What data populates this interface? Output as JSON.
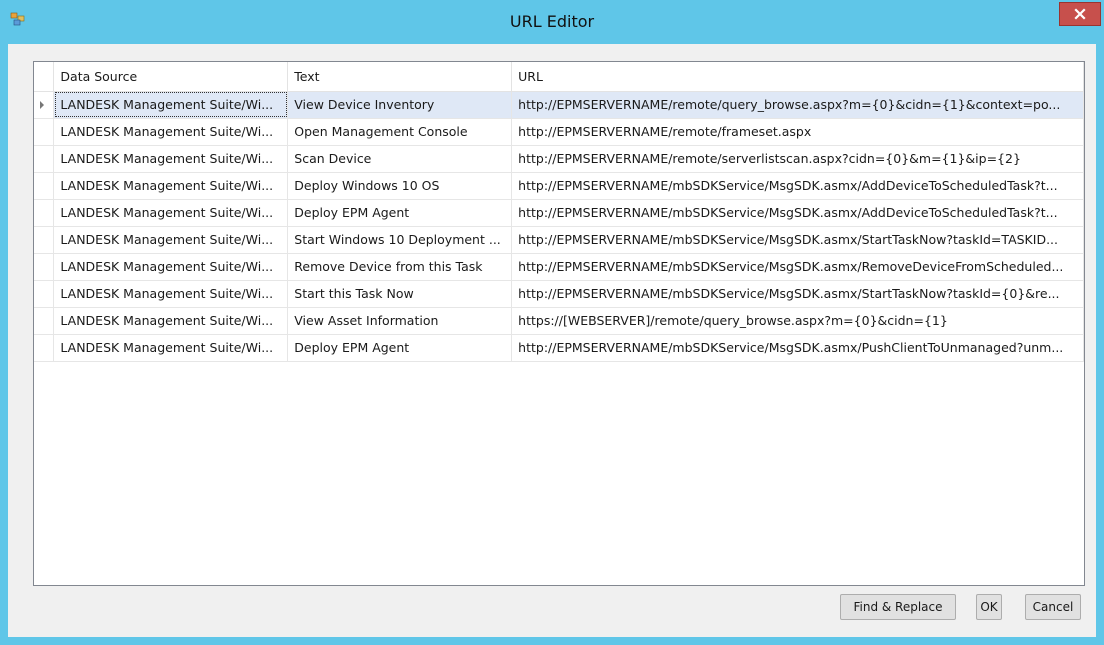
{
  "window": {
    "title": "URL Editor",
    "accent_color": "#5fc6e8",
    "close_color": "#c7504c",
    "icon": "app-icon"
  },
  "grid": {
    "columns": [
      "Data Source",
      "Text",
      "URL"
    ],
    "selected_row": 0,
    "rows": [
      {
        "source": "LANDESK Management Suite/Wi...",
        "text": "View Device Inventory",
        "url": "http://EPMSERVERNAME/remote/query_browse.aspx?m={0}&cidn={1}&context=po..."
      },
      {
        "source": "LANDESK Management Suite/Wi...",
        "text": "Open Management Console",
        "url": "http://EPMSERVERNAME/remote/frameset.aspx"
      },
      {
        "source": "LANDESK Management Suite/Wi...",
        "text": "Scan Device",
        "url": "http://EPMSERVERNAME/remote/serverlistscan.aspx?cidn={0}&m={1}&ip={2}"
      },
      {
        "source": "LANDESK Management Suite/Wi...",
        "text": "Deploy Windows 10 OS",
        "url": "http://EPMSERVERNAME/mbSDKService/MsgSDK.asmx/AddDeviceToScheduledTask?t..."
      },
      {
        "source": "LANDESK Management Suite/Wi...",
        "text": "Deploy EPM Agent",
        "url": "http://EPMSERVERNAME/mbSDKService/MsgSDK.asmx/AddDeviceToScheduledTask?t..."
      },
      {
        "source": "LANDESK Management Suite/Wi...",
        "text": "Start Windows 10 Deployment ...",
        "url": "http://EPMSERVERNAME/mbSDKService/MsgSDK.asmx/StartTaskNow?taskId=TASKID..."
      },
      {
        "source": "LANDESK Management Suite/Wi...",
        "text": "Remove Device from this Task",
        "url": "http://EPMSERVERNAME/mbSDKService/MsgSDK.asmx/RemoveDeviceFromScheduled..."
      },
      {
        "source": "LANDESK Management Suite/Wi...",
        "text": "Start this Task Now",
        "url": "http://EPMSERVERNAME/mbSDKService/MsgSDK.asmx/StartTaskNow?taskId={0}&re..."
      },
      {
        "source": "LANDESK Management Suite/Wi...",
        "text": "View Asset Information",
        "url": "https://[WEBSERVER]/remote/query_browse.aspx?m={0}&cidn={1}"
      },
      {
        "source": "LANDESK Management Suite/Wi...",
        "text": "Deploy EPM Agent",
        "url": "http://EPMSERVERNAME/mbSDKService/MsgSDK.asmx/PushClientToUnmanaged?unm..."
      }
    ]
  },
  "buttons": {
    "find_replace": "Find & Replace",
    "ok": "OK",
    "cancel": "Cancel"
  }
}
